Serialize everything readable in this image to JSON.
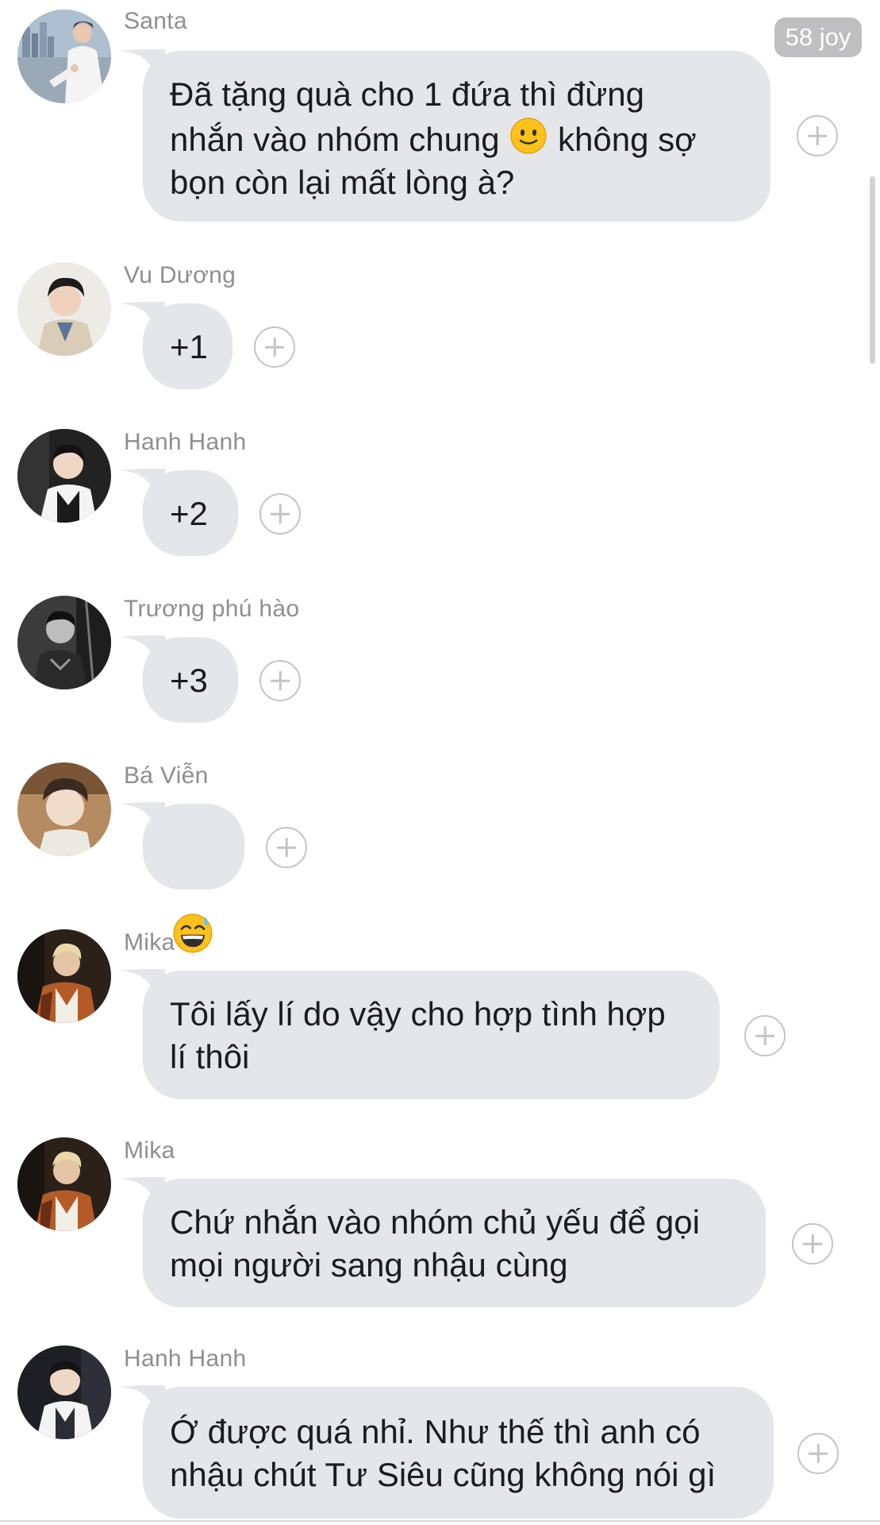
{
  "chat": {
    "reaction_badge": "58 joy",
    "messages": [
      {
        "sender": "Santa",
        "text_before_emoji": "Đã tặng quà cho 1 đứa thì đừng\nnhắn vào nhóm chung ",
        "inline_emoji": "slightly-smiling-face-emoji",
        "text_after_emoji": " không sợ\nbọn còn lại mất lòng à?"
      },
      {
        "sender": "Vu Dương",
        "text": "+1"
      },
      {
        "sender": "Hanh Hanh",
        "text": "+2"
      },
      {
        "sender": "Trương phú hào",
        "text": "+3"
      },
      {
        "sender": "Bá Viễn",
        "emoji": "grinning-face-with-sweat-emoji"
      },
      {
        "sender": "Mika",
        "text": "Tôi lấy lí do vậy cho hợp tình hợp\nlí thôi"
      },
      {
        "sender": "Mika",
        "text": "Chứ nhắn vào nhóm chủ yếu để gọi\nmọi người sang nhậu cùng"
      },
      {
        "sender": "Hanh Hanh",
        "text": "Ớ được quá nhỉ. Như thế thì anh có\nnhậu chút Tư Siêu cũng không nói gì"
      }
    ]
  },
  "icons": {
    "add_reaction": "plus-circle-icon"
  },
  "colors": {
    "bubble": "#e4e6ea",
    "sender_name": "#8e8e93",
    "badge_bg": "#bfbfc1",
    "background": "#ffffff"
  }
}
